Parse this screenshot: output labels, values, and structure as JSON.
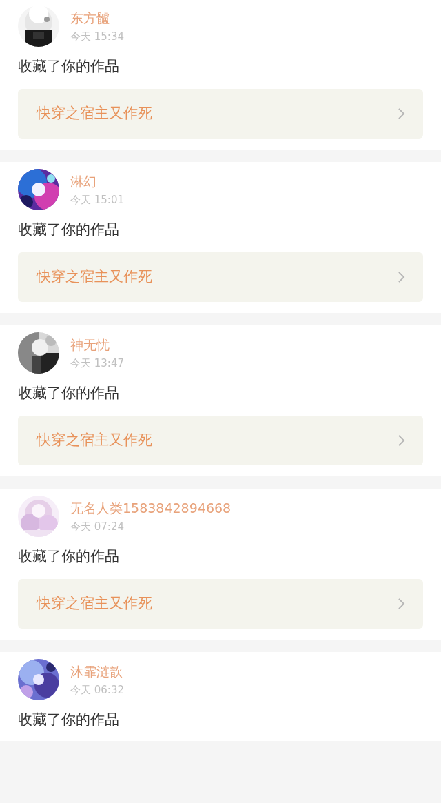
{
  "notifications": [
    {
      "user": "东方髗",
      "time": "今天 15:34",
      "action": "收藏了你的作品",
      "work": {
        "title": "快穿之宿主又作死"
      }
    },
    {
      "user": "淋幻",
      "time": "今天 15:01",
      "action": "收藏了你的作品",
      "work": {
        "title": "快穿之宿主又作死"
      }
    },
    {
      "user": "神无忧",
      "time": "今天 13:47",
      "action": "收藏了你的作品",
      "work": {
        "title": "快穿之宿主又作死"
      }
    },
    {
      "user": "无名人类1583842894668",
      "time": "今天 07:24",
      "action": "收藏了你的作品",
      "work": {
        "title": "快穿之宿主又作死"
      }
    },
    {
      "user": "沐霏涟歆",
      "time": "今天 06:32",
      "action": "收藏了你的作品"
    }
  ]
}
